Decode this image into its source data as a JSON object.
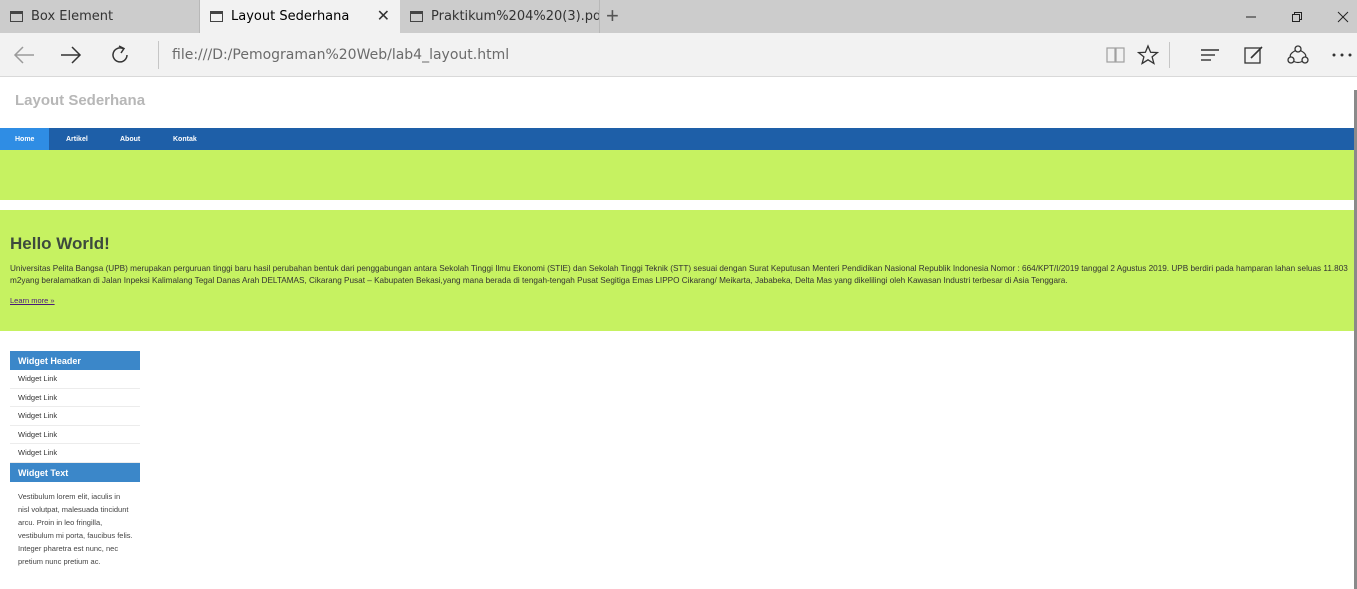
{
  "browser": {
    "tabs": [
      {
        "title": "Box Element",
        "active": false
      },
      {
        "title": "Layout Sederhana",
        "active": true
      },
      {
        "title": "Praktikum%204%20(3).pdf",
        "active": false
      }
    ],
    "url": "file:///D:/Pemograman%20Web/lab4_layout.html"
  },
  "page": {
    "site_title": "Layout Sederhana",
    "nav": [
      {
        "label": "Home",
        "active": true
      },
      {
        "label": "Artikel",
        "active": false
      },
      {
        "label": "About",
        "active": false
      },
      {
        "label": "Kontak",
        "active": false
      }
    ],
    "hero": {
      "heading": "Hello World!",
      "body": "Universitas Pelita Bangsa (UPB) merupakan perguruan tinggi baru hasil perubahan bentuk dari penggabungan antara Sekolah Tinggi Ilmu Ekonomi (STIE) dan Sekolah Tinggi Teknik (STT) sesuai dengan Surat Keputusan Menteri Pendidikan Nasional Republik Indonesia Nomor : 664/KPT/I/2019 tanggal 2 Agustus 2019. UPB berdiri pada hamparan lahan seluas 11.803 m2yang beralamatkan di Jalan Inpeksi Kalimalang Tegal Danas Arah DELTAMAS, Cikarang Pusat – Kabupaten Bekasi,yang mana berada di tengah-tengah Pusat Segitiga Emas LIPPO Cikarang/ Meikarta, Jababeka, Delta Mas yang dikelilingi oleh Kawasan Industri terbesar di Asia Tenggara.",
      "link": "Learn more »"
    },
    "sidebar": {
      "widget_header": "Widget Header",
      "links": [
        "Widget Link",
        "Widget Link",
        "Widget Link",
        "Widget Link",
        "Widget Link"
      ],
      "widget_text_title": "Widget Text",
      "widget_text": "Vestibulum lorem elit, iaculis in nisl volutpat, malesuada tincidunt arcu. Proin in leo fringilla, vestibulum mi porta, faucibus felis. Integer pharetra est nunc, nec pretium nunc pretium ac."
    }
  },
  "colors": {
    "nav_bg": "#1e5fa8",
    "nav_active": "#2f8de4",
    "hero_bg": "#c6f261",
    "widget_header": "#3b87c9"
  },
  "icons": {
    "tab": "tab-page-icon",
    "close": "close-icon",
    "new_tab": "plus-icon",
    "back": "back-arrow-icon",
    "forward": "forward-arrow-icon",
    "refresh": "refresh-icon",
    "reading_view": "book-icon",
    "favorite": "star-icon",
    "hub": "hub-icon",
    "notes": "pen-icon",
    "share": "share-icon",
    "more": "more-icon"
  }
}
